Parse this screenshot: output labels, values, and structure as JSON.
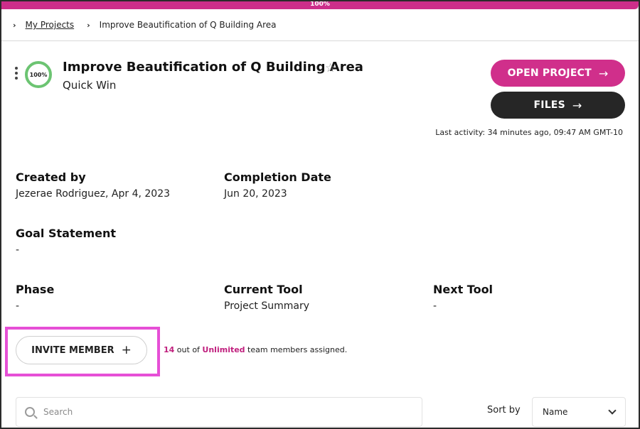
{
  "progress": {
    "label": "100%",
    "percent": 100
  },
  "breadcrumb": {
    "chevron": "›",
    "root_link": "My Projects",
    "current": "Improve Beautification of Q Building Area"
  },
  "project": {
    "completion_ring": "100%",
    "title": "Improve Beautification of Q Building Area",
    "subtitle": "Quick Win",
    "star_icon": "☆"
  },
  "actions": {
    "open_label": "OPEN PROJECT",
    "files_label": "FILES",
    "arrow_icon": "→"
  },
  "last_activity": "Last activity: 34 minutes ago, 09:47 AM GMT-10",
  "details": {
    "created_by": {
      "label": "Created by",
      "value": "Jezerae Rodriguez, Apr 4, 2023"
    },
    "completion_date": {
      "label": "Completion Date",
      "value": "Jun 20, 2023"
    },
    "goal_statement": {
      "label": "Goal Statement",
      "value": "-"
    },
    "phase": {
      "label": "Phase",
      "value": "-"
    },
    "current_tool": {
      "label": "Current Tool",
      "value": "Project Summary"
    },
    "next_tool": {
      "label": "Next Tool",
      "value": "-"
    }
  },
  "team": {
    "invite_label": "INVITE MEMBER",
    "plus_icon": "+",
    "assigned_count": "14",
    "text_out_of": " out of ",
    "limit": "Unlimited",
    "text_suffix": " team members assigned."
  },
  "search": {
    "placeholder": "Search"
  },
  "sort": {
    "label": "Sort by",
    "selected": "Name"
  },
  "colors": {
    "accent": "#d02f8b",
    "dark_button": "#262626",
    "ring": "#6cc472",
    "highlight": "#e64fd6"
  }
}
